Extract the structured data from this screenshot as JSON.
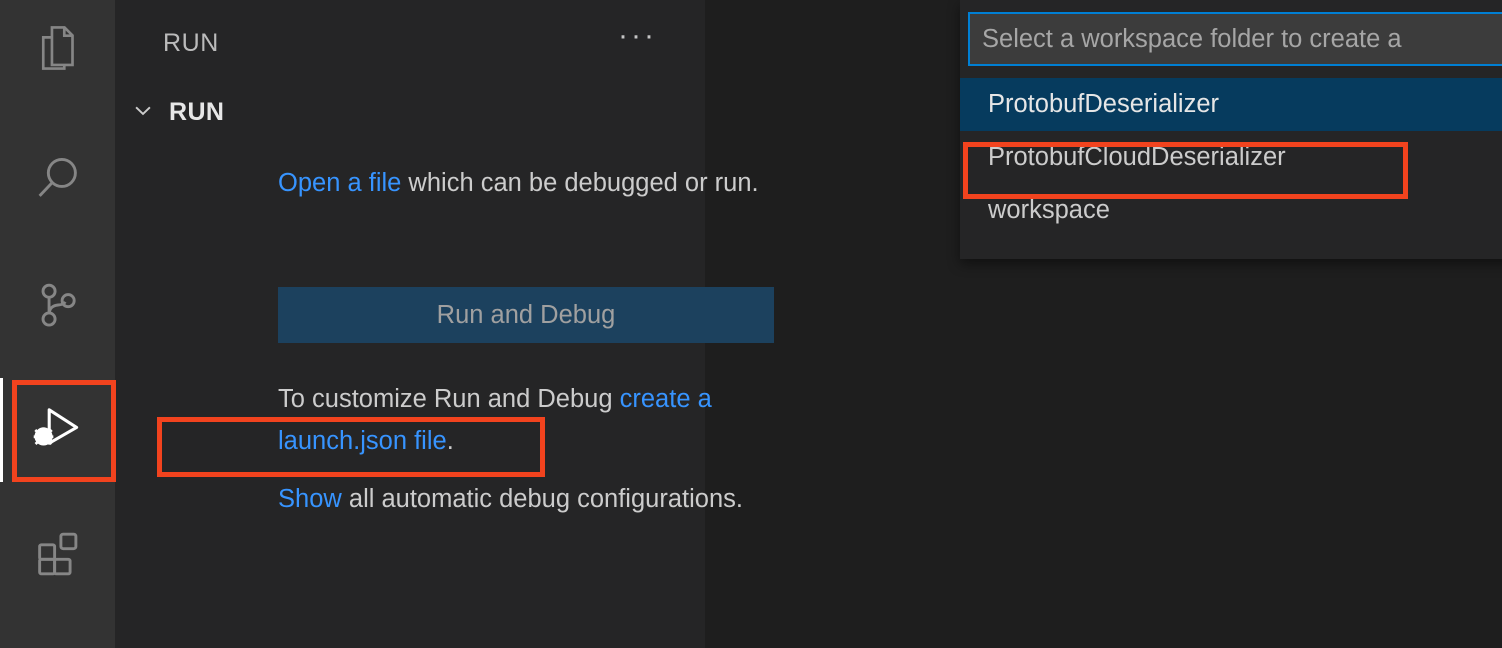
{
  "window": {
    "app": "Visual Studio Code",
    "editor_background": "#1e1e1e",
    "sidebar_background": "#252526",
    "activitybar_background": "#333333",
    "accent_blue": "#3794ff",
    "annotation_red": "#f2431e",
    "selection_blue": "#063b5e",
    "focus_border": "#007fd4"
  },
  "activity_bar": {
    "items": [
      {
        "name": "explorer",
        "icon": "files-icon",
        "active": false
      },
      {
        "name": "search",
        "icon": "search-icon",
        "active": false
      },
      {
        "name": "source-control",
        "icon": "source-control-icon",
        "active": false
      },
      {
        "name": "run-and-debug",
        "icon": "run-and-debug-icon",
        "active": true
      },
      {
        "name": "extensions",
        "icon": "extensions-icon",
        "active": false
      }
    ]
  },
  "sidebar": {
    "title": "RUN",
    "more_actions": "···",
    "section": {
      "label": "RUN",
      "expanded": true,
      "chevron": "chevron-down-icon"
    },
    "welcome": {
      "line1_link": "Open a file",
      "line1_rest": " which can be debugged or run.",
      "run_debug_button": "Run and Debug",
      "line2_prefix": "To customize Run and Debug ",
      "line2_link": "create a launch.json file",
      "line2_suffix": ".",
      "line3_link": "Show",
      "line3_rest": " all automatic debug configurations."
    }
  },
  "quick_pick": {
    "input_placeholder": "Select a workspace folder to create a",
    "input_value": "",
    "items": [
      {
        "label": "ProtobufDeserializer",
        "selected": true
      },
      {
        "label": "ProtobufCloudDeserializer",
        "selected": false
      },
      {
        "label": "workspace",
        "selected": false
      }
    ]
  },
  "annotations": [
    {
      "name": "annotation-run-and-debug-activity-icon"
    },
    {
      "name": "annotation-create-launch-json-link"
    },
    {
      "name": "annotation-protobuf-cloud-deserializer-item"
    }
  ]
}
